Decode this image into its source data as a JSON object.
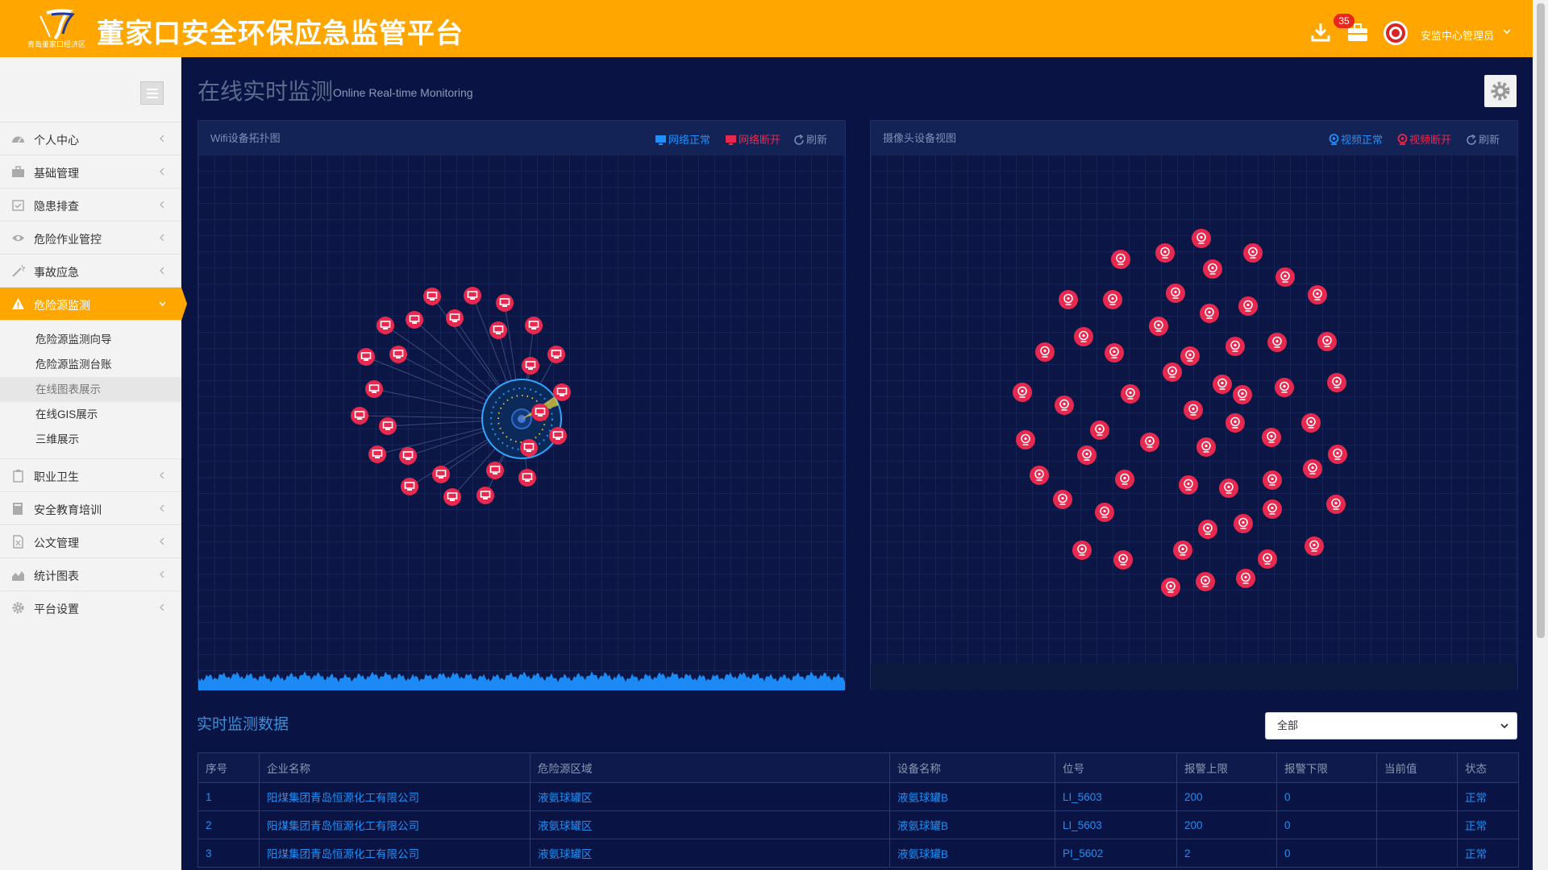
{
  "header": {
    "logo_text": "青岛董家口经济区",
    "title": "董家口安全环保应急监管平台",
    "badge_count": "35",
    "user_name": "安监中心管理员",
    "brand_color": "#ffa700"
  },
  "icons": {
    "download": "download-icon",
    "briefcase": "briefcase-icon",
    "gear": "gear-icon",
    "menu": "hamburger-icon"
  },
  "sidebar": {
    "items": [
      {
        "label": "个人中心",
        "icon": "dashboard-icon"
      },
      {
        "label": "基础管理",
        "icon": "briefcase-icon"
      },
      {
        "label": "隐患排查",
        "icon": "calendar-check-icon"
      },
      {
        "label": "危险作业管控",
        "icon": "eye-icon"
      },
      {
        "label": "事故应急",
        "icon": "magic-wand-icon"
      },
      {
        "label": "危险源监测",
        "icon": "warning-icon"
      },
      {
        "label": "职业卫生",
        "icon": "clipboard-icon"
      },
      {
        "label": "安全教育培训",
        "icon": "book-icon"
      },
      {
        "label": "公文管理",
        "icon": "document-icon"
      },
      {
        "label": "统计图表",
        "icon": "area-chart-icon"
      },
      {
        "label": "平台设置",
        "icon": "gear-icon"
      }
    ],
    "submenu": [
      "危险源监测向导",
      "危险源监测台账",
      "在线图表展示",
      "在线GIS展示",
      "三维展示"
    ]
  },
  "page": {
    "title": "在线实时监测",
    "subtitle": "Online Real-time Monitoring"
  },
  "wifi_panel": {
    "title": "Wifi设备拓扑图",
    "legend_normal": "网络正常",
    "legend_disconnected": "网络断开",
    "refresh": "刷新",
    "normal_color": "#1e90ff",
    "disconnected_color": "#e8294f"
  },
  "camera_panel": {
    "title": "摄像头设备视图",
    "legend_normal": "视频正常",
    "legend_disconnected": "视频断开",
    "refresh": "刷新",
    "normal_color": "#1e90ff",
    "disconnected_color": "#e8294f"
  },
  "monitor": {
    "title": "实时监测数据",
    "filter_value": "全部",
    "columns": [
      "序号",
      "企业名称",
      "危险源区域",
      "设备名称",
      "位号",
      "报警上限",
      "报警下限",
      "当前值",
      "状态"
    ],
    "rows": [
      [
        "1",
        "阳煤集团青岛恒源化工有限公司",
        "液氨球罐区",
        "液氨球罐B",
        "LI_5603",
        "200",
        "0",
        "",
        "正常"
      ],
      [
        "2",
        "阳煤集团青岛恒源化工有限公司",
        "液氨球罐区",
        "液氨球罐B",
        "LI_5603",
        "200",
        "0",
        "",
        "正常"
      ],
      [
        "3",
        "阳煤集团青岛恒源化工有限公司",
        "液氨球罐区",
        "液氨球罐B",
        "PI_5602",
        "2",
        "0",
        "",
        "正常"
      ]
    ]
  }
}
